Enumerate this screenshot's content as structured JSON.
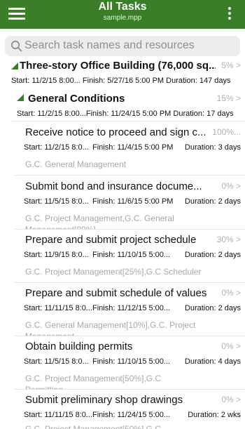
{
  "header": {
    "title": "All Tasks",
    "subtitle": "sample.mpp",
    "accent_color": "#3a7f28",
    "menu_icon": "hamburger-menu-icon",
    "more_icon": "more-vertical-icon"
  },
  "search": {
    "placeholder": "Search task names and resources",
    "icon": "search-icon"
  },
  "project": {
    "name": "Three-story Office Building (76,000 sq...",
    "percent": "5% >",
    "dates": "Start: 11/2/15 8:00...  Finish: 5/27/16 5:00 PM  Duration: 147 days"
  },
  "summary": {
    "name": "General Conditions",
    "percent": "15% >",
    "dates": "Start: 11/2/15 8:00...Finish: 11/24/15 5:00 PM   Duration: 17 days"
  },
  "tasks": [
    {
      "name": "Receive notice to proceed and sign c...",
      "percent": "100%...",
      "start": "Start: 11/2/15 8:0...",
      "finish": "Finish: 11/4/15 5:00 PM",
      "duration": "Duration: 3 days",
      "resources": "G.C. General Management",
      "resources2": ""
    },
    {
      "name": "Submit bond and insurance docume...",
      "percent": "0% >",
      "start": "Start: 11/5/15 8:0...",
      "finish": "Finish: 11/6/15 5:00 PM",
      "duration": "Duration: 2 days",
      "resources": "G.C. Project Management,G.C. General",
      "resources2": "Management[80%]"
    },
    {
      "name": "Prepare and submit project schedule",
      "percent": "30% >",
      "start": "Start: 11/9/15 8:0...",
      "finish": "Finish: 11/10/15 5:00...",
      "duration": "Duration: 2 days",
      "resources": "G.C. Project Management[25%],G.C Scheduler",
      "resources2": ""
    },
    {
      "name": "Prepare and submit schedule of values",
      "percent": "0% >",
      "start": "Start: 11/11/15 8:0...",
      "finish": "Finish: 11/12/15 5:00...",
      "duration": "Duration: 2 days",
      "resources": "G.C. General Management[10%],G.C. Project",
      "resources2": "Management"
    },
    {
      "name": "Obtain building permits",
      "percent": "0% >",
      "start": "Start: 11/5/15 8:0...",
      "finish": "Finish: 11/10/15 5:00...",
      "duration": "Duration: 4 days",
      "resources": "G.C. Project Management[50%],G.C",
      "resources2": "Permitting"
    },
    {
      "name": "Submit preliminary shop drawings",
      "percent": "0% >",
      "start": "Start: 11/11/15 8:0...",
      "finish": "Finish: 11/24/15 5:00...",
      "duration": "Duration: 2 wks",
      "resources": "G.C. Project Management[50%],G.C",
      "resources2": ""
    }
  ]
}
